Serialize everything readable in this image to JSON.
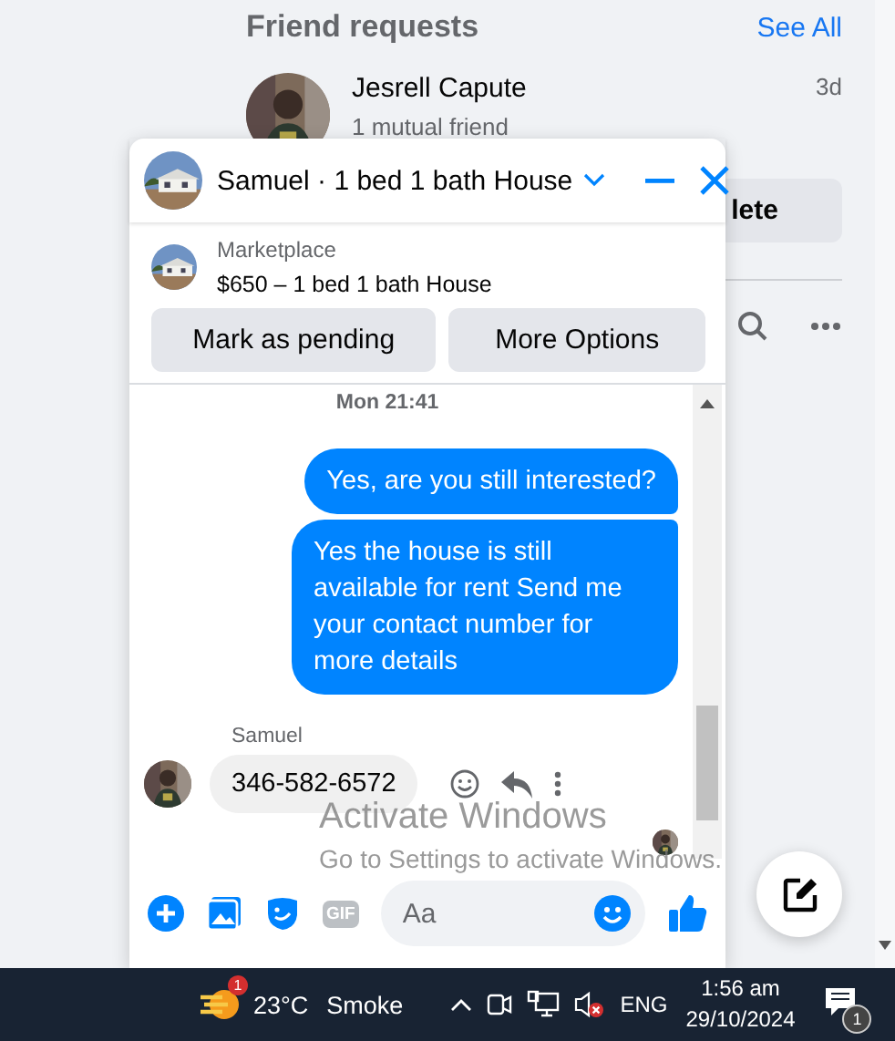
{
  "friend_requests": {
    "title": "Friend requests",
    "see_all": "See All",
    "items": [
      {
        "name": "Jesrell Capute",
        "time": "3d",
        "mutual": "1 mutual friend",
        "button": "lete"
      }
    ]
  },
  "chat": {
    "title": "Samuel · 1 bed 1 bath House",
    "listing": {
      "source": "Marketplace",
      "title": "$650 – 1 bed 1 bath House"
    },
    "actions": [
      "Mark as pending",
      "More Options"
    ],
    "timestamp": "Mon 21:41",
    "messages": [
      {
        "kind": "outgoing",
        "text": "Yes, are you still interested?"
      },
      {
        "kind": "outgoing",
        "text": "Yes the house is still available for rent Send me your contact number for more details"
      },
      {
        "kind": "incoming",
        "sender": "Samuel",
        "text": "346-582-6572"
      }
    ],
    "composer": {
      "gif_label": "GIF",
      "placeholder": "Aa"
    }
  },
  "activation": {
    "title": "Activate Windows",
    "subtitle": "Go to Settings to activate Windows."
  },
  "taskbar": {
    "weather_badge": "1",
    "temperature": "23°C",
    "condition": "Smoke",
    "language": "ENG",
    "time": "1:56 am",
    "date": "29/10/2024",
    "notifications": "1"
  }
}
